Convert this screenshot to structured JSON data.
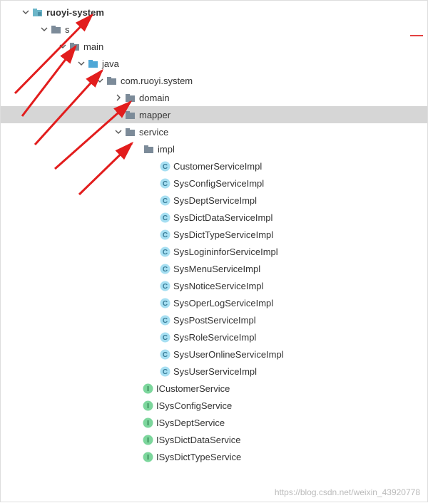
{
  "colors": {
    "folder": "#6cb6c9",
    "folder_dark": "#7c8b99",
    "source_folder": "#4fa7d6",
    "class_bg": "#a6dff2",
    "class_fg": "#3a7d98",
    "interface_bg": "#7cd69c",
    "interface_fg": "#2a7a4a",
    "arrow": "#e21d1d"
  },
  "tree": {
    "root": {
      "label": "ruoyi-system",
      "expanded": true
    },
    "src": {
      "label": "src",
      "expanded": true
    },
    "main": {
      "label": "main",
      "expanded": true
    },
    "java": {
      "label": "java",
      "expanded": true
    },
    "pkg": {
      "label": "com.ruoyi.system",
      "expanded": true
    },
    "domain": {
      "label": "domain",
      "expanded": false
    },
    "mapper": {
      "label": "mapper",
      "expanded": false,
      "selected": true
    },
    "service": {
      "label": "service",
      "expanded": true
    },
    "impl": {
      "label": "impl",
      "expanded": true
    },
    "impl_classes": [
      "CustomerServiceImpl",
      "SysConfigServiceImpl",
      "SysDeptServiceImpl",
      "SysDictDataServiceImpl",
      "SysDictTypeServiceImpl",
      "SysLogininforServiceImpl",
      "SysMenuServiceImpl",
      "SysNoticeServiceImpl",
      "SysOperLogServiceImpl",
      "SysPostServiceImpl",
      "SysRoleServiceImpl",
      "SysUserOnlineServiceImpl",
      "SysUserServiceImpl"
    ],
    "service_interfaces": [
      "ICustomerService",
      "ISysConfigService",
      "ISysDeptService",
      "ISysDictDataService",
      "ISysDictTypeService"
    ]
  },
  "watermark": "https://blog.csdn.net/weixin_43920778"
}
